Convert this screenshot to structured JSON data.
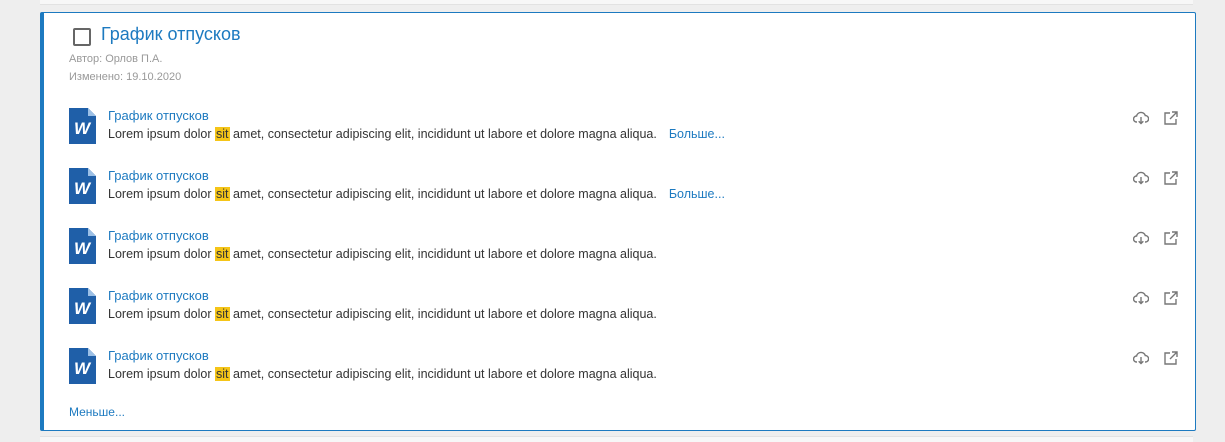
{
  "card": {
    "title": "График отпусков",
    "author": "Автор: Орлов П.А.",
    "modified": "Изменено: 19.10.2020",
    "less_label": "Меньше..."
  },
  "docs": [
    {
      "title": "График отпусков",
      "pre": "Lorem ipsum dolor ",
      "highlight": "sit",
      "post": " amet, consectetur adipiscing elit, incididunt ut labore et dolore magna aliqua.",
      "more": "Больше..."
    },
    {
      "title": "График отпусков",
      "pre": "Lorem ipsum dolor ",
      "highlight": "sit",
      "post": " amet, consectetur adipiscing elit, incididunt ut labore et dolore magna aliqua.",
      "more": "Больше..."
    },
    {
      "title": "График отпусков",
      "pre": "Lorem ipsum dolor ",
      "highlight": "sit",
      "post": " amet, consectetur adipiscing elit, incididunt ut labore et dolore magna aliqua.",
      "more": ""
    },
    {
      "title": "График отпусков",
      "pre": "Lorem ipsum dolor ",
      "highlight": "sit",
      "post": " amet, consectetur adipiscing elit, incididunt ut labore et dolore magna aliqua.",
      "more": ""
    },
    {
      "title": "График отпусков",
      "pre": "Lorem ipsum dolor ",
      "highlight": "sit",
      "post": " amet, consectetur adipiscing elit, incididunt ut labore et dolore magna aliqua.",
      "more": ""
    }
  ],
  "icons": {
    "file": "word-document-icon",
    "download": "cloud-download-icon",
    "open": "open-external-icon",
    "select": "checkbox"
  },
  "colors": {
    "accent": "#1d7ac0",
    "highlight": "#f5c518",
    "word_blue": "#1f5fa8"
  }
}
